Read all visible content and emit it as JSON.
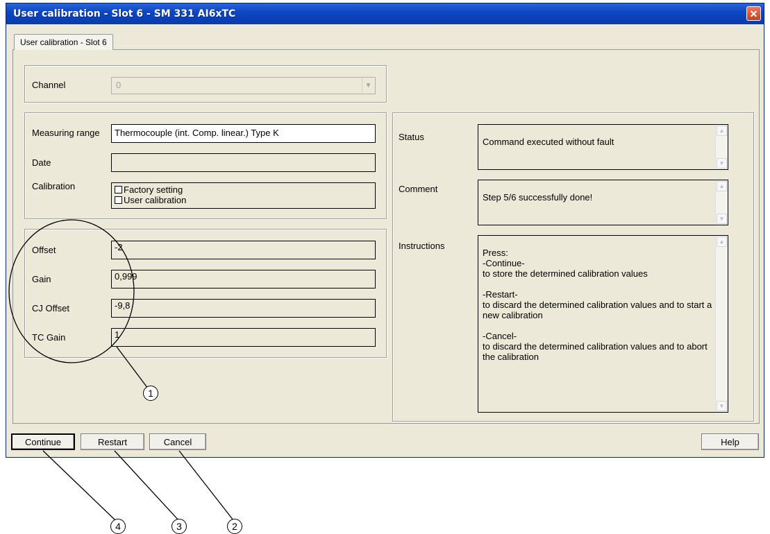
{
  "window": {
    "title": "User calibration - Slot 6 - SM 331 AI6xTC",
    "close_glyph": "✕"
  },
  "tab": {
    "label": "User calibration - Slot 6"
  },
  "channel": {
    "label": "Channel",
    "value": "0"
  },
  "info": {
    "measuring_range_label": "Measuring range",
    "measuring_range_value": "Thermocouple (int. Comp. linear.) Type K",
    "date_label": "Date",
    "date_value": "",
    "calibration_label": "Calibration",
    "factory_setting": "Factory setting",
    "user_calibration": "User calibration"
  },
  "values": {
    "offset_label": "Offset",
    "offset_value": "-2",
    "gain_label": "Gain",
    "gain_value": "0,999",
    "cj_offset_label": "CJ Offset",
    "cj_offset_value": "-9,8",
    "tc_gain_label": "TC Gain",
    "tc_gain_value": "1"
  },
  "status": {
    "status_label": "Status",
    "status_value": "Command executed without fault",
    "comment_label": "Comment",
    "comment_value": "Step 5/6 successfully done!",
    "instructions_label": "Instructions",
    "instructions_value": "Press:\n-Continue-\nto store the determined calibration values\n\n-Restart-\nto discard the determined calibration values and to start a new calibration\n\n-Cancel-\nto discard the determined calibration values and to abort the calibration"
  },
  "buttons": {
    "continue": "Continue",
    "restart": "Restart",
    "cancel": "Cancel",
    "help": "Help"
  },
  "callouts": {
    "c1": "1",
    "c2": "2",
    "c3": "3",
    "c4": "4"
  },
  "icons": [
    "close-icon",
    "dropdown-arrow-icon",
    "scroll-up-icon",
    "scroll-down-icon"
  ]
}
